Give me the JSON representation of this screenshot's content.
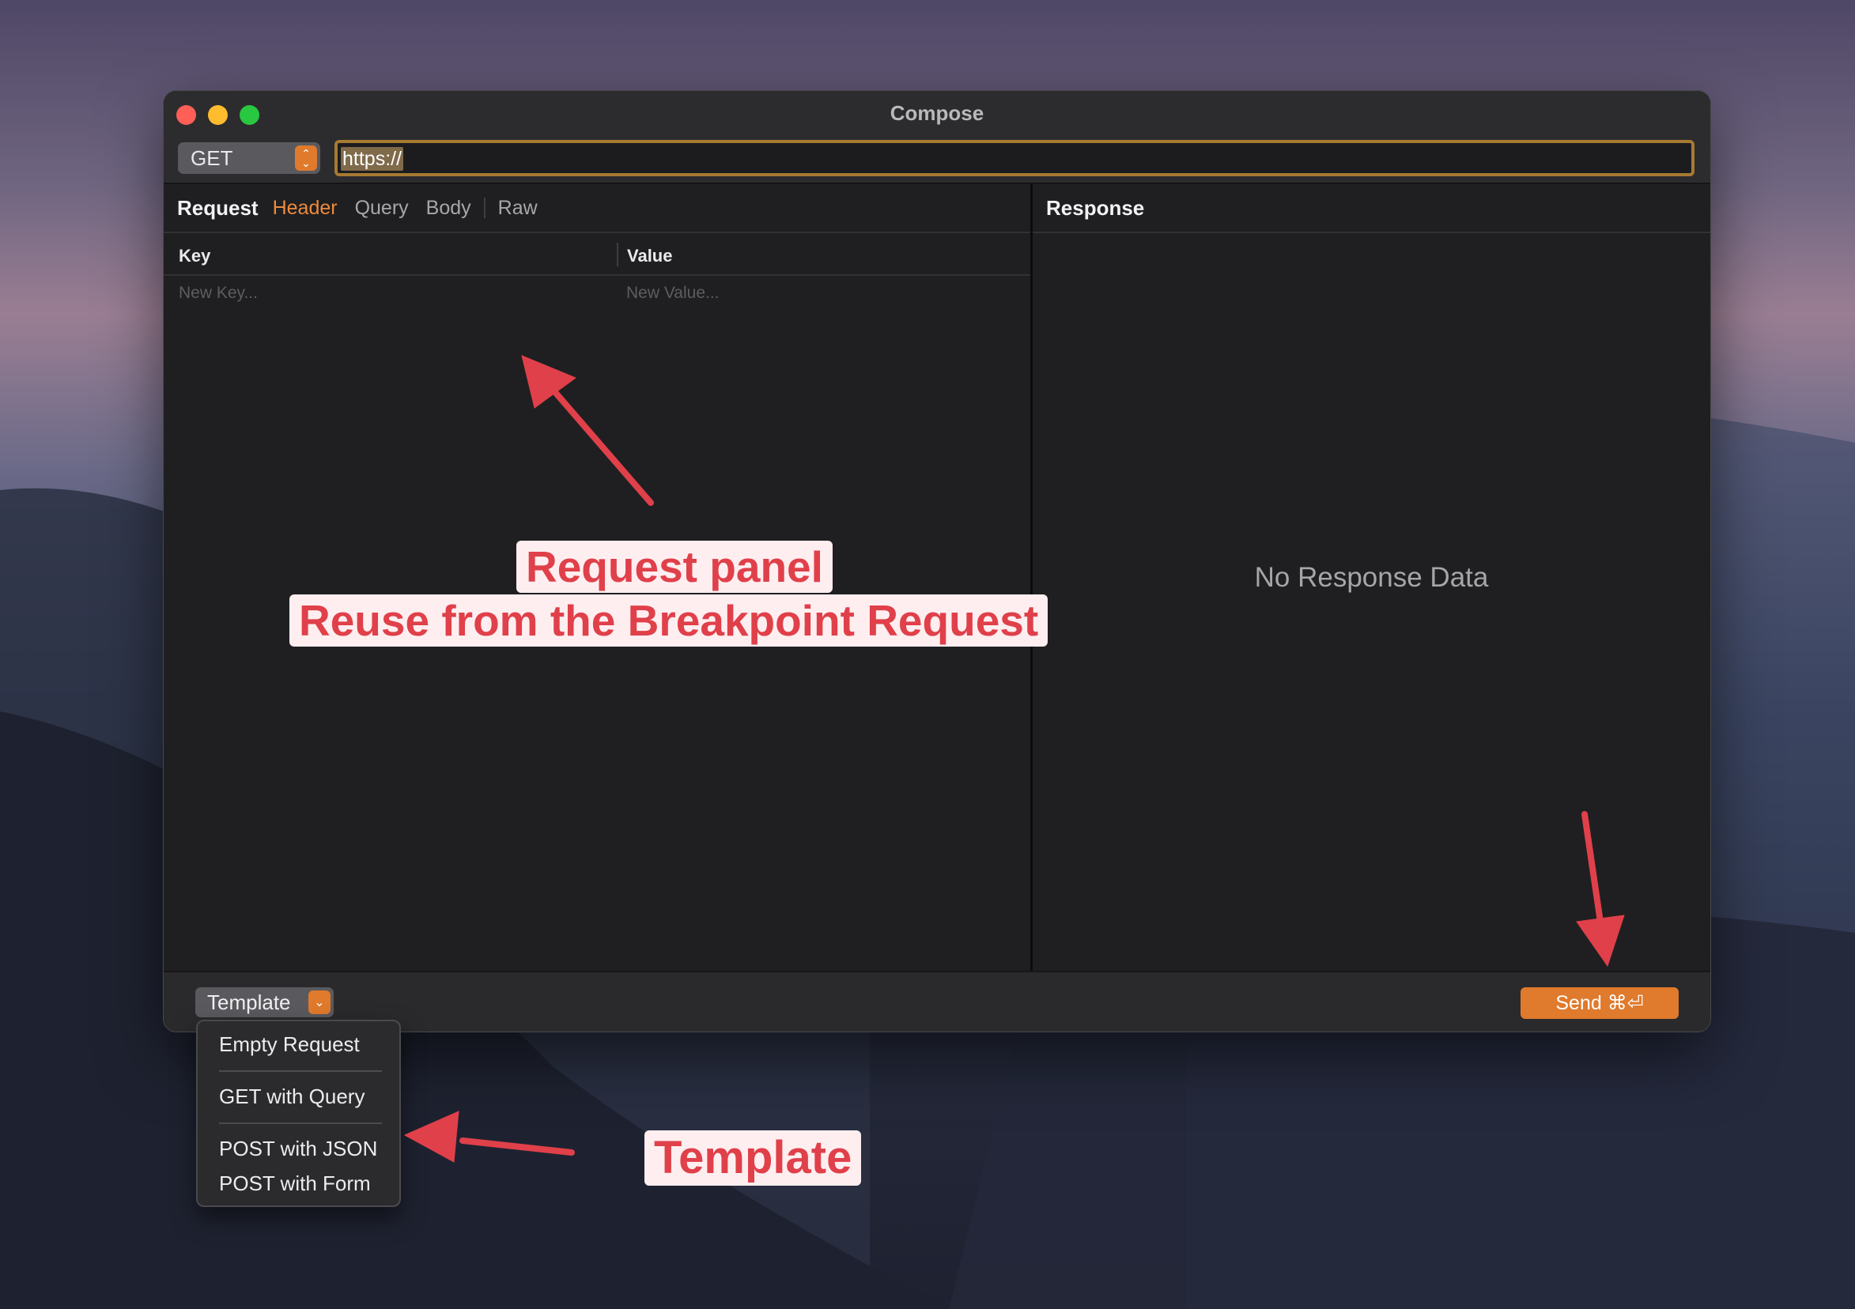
{
  "window": {
    "title": "Compose"
  },
  "toolbar": {
    "method": "GET",
    "url_value": "https://"
  },
  "request": {
    "title": "Request",
    "tabs": [
      {
        "label": "Header",
        "active": true
      },
      {
        "label": "Query",
        "active": false
      },
      {
        "label": "Body",
        "active": false
      },
      {
        "label": "Raw",
        "active": false
      }
    ],
    "columns": {
      "key": "Key",
      "value": "Value"
    },
    "new_row": {
      "key_placeholder": "New Key...",
      "value_placeholder": "New Value..."
    }
  },
  "response": {
    "title": "Response",
    "empty_text": "No Response Data"
  },
  "footer": {
    "template_label": "Template",
    "send_label": "Send ⌘⏎"
  },
  "template_menu": {
    "items": [
      "Empty Request",
      "GET with Query",
      "POST with JSON",
      "POST with Form"
    ]
  },
  "annotations": {
    "request_panel": "Request panel",
    "reuse": "Reuse from the Breakpoint Request",
    "template": "Template"
  },
  "colors": {
    "accent": "#e07a2c",
    "annotation": "#e0404a",
    "url_border": "#a77a32"
  }
}
